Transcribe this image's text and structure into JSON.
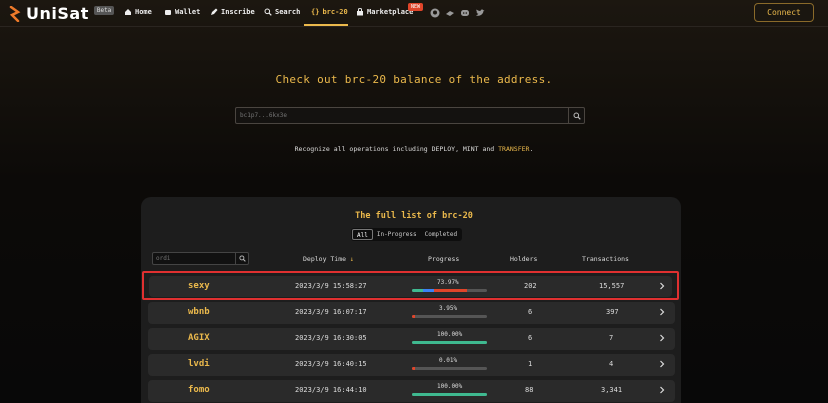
{
  "header": {
    "logo_text": "UniSat",
    "beta_badge": "Beta",
    "nav": [
      {
        "label": "Home",
        "icon": "home-icon"
      },
      {
        "label": "Wallet",
        "icon": "wallet-icon"
      },
      {
        "label": "Inscribe",
        "icon": "pen-icon"
      },
      {
        "label": "Search",
        "icon": "search-icon"
      },
      {
        "label": "brc-20",
        "icon": "braces-icon",
        "active": true
      },
      {
        "label": "Marketplace",
        "icon": "bag-icon"
      }
    ],
    "new_badge": "NEW",
    "social_icons": [
      "github-icon",
      "gitbook-icon",
      "discord-icon",
      "twitter-icon"
    ],
    "connect_label": "Connect"
  },
  "hero": {
    "title": "Check out brc-20 balance of the address.",
    "search_placeholder": "bc1p7...6kx3e",
    "sub_prefix": "Recognize all operations including DEPLOY, MINT and",
    "sub_highlight": "TRANSFER",
    "sub_suffix": "."
  },
  "list": {
    "title": "The full list of brc-20",
    "filters": [
      "All",
      "In-Progress",
      "Completed"
    ],
    "active_filter": "All",
    "ticker_search_placeholder": "ordi",
    "columns": {
      "deploy_time": "Deploy Time",
      "progress": "Progress",
      "holders": "Holders",
      "transactions": "Transactions"
    },
    "rows": [
      {
        "tick": "sexy",
        "deploy_time": "2023/3/9 15:58:27",
        "progress_label": "73.97%",
        "progress": 73.97,
        "holders": "202",
        "transactions": "15,557",
        "bar": "multi"
      },
      {
        "tick": "wbnb",
        "deploy_time": "2023/3/9 16:07:17",
        "progress_label": "3.95%",
        "progress": 3.95,
        "holders": "6",
        "transactions": "397",
        "bar": "red"
      },
      {
        "tick": "AGIX",
        "deploy_time": "2023/3/9 16:30:05",
        "progress_label": "100.00%",
        "progress": 100,
        "holders": "6",
        "transactions": "7",
        "bar": "green"
      },
      {
        "tick": "lvdi",
        "deploy_time": "2023/3/9 16:40:15",
        "progress_label": "0.01%",
        "progress": 0.01,
        "holders": "1",
        "transactions": "4",
        "bar": "red"
      },
      {
        "tick": "fomo",
        "deploy_time": "2023/3/9 16:44:10",
        "progress_label": "100.00%",
        "progress": 100,
        "holders": "88",
        "transactions": "3,341",
        "bar": "green"
      }
    ]
  },
  "colors": {
    "accent": "#ebb94c",
    "green": "#3fb990",
    "red": "#e0452a",
    "blue": "#3b82f6",
    "highlight_border": "#e03030"
  }
}
